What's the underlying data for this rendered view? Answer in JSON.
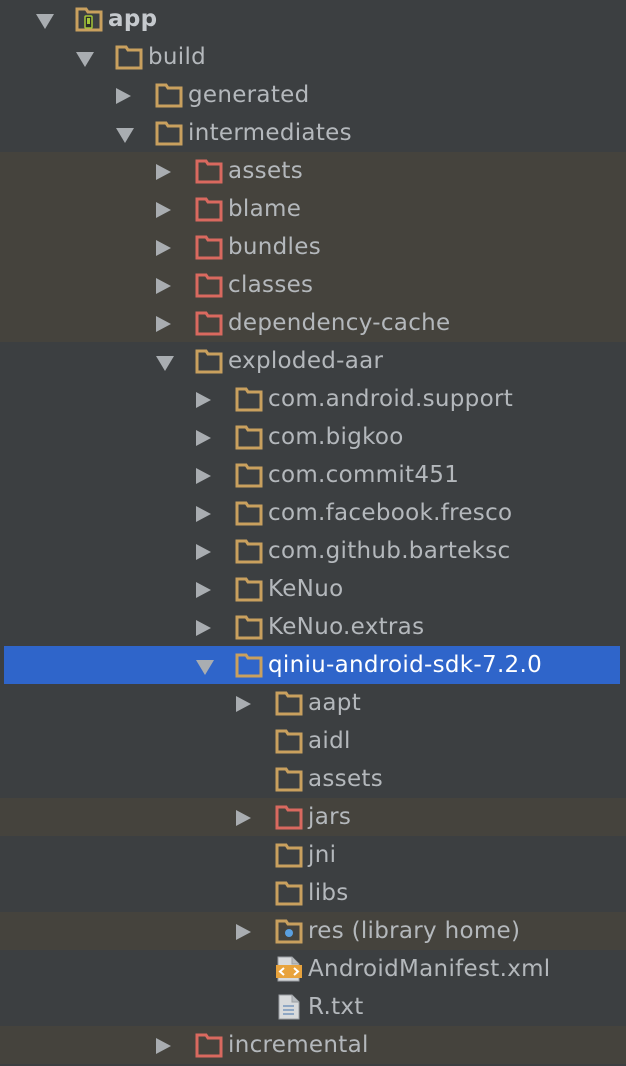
{
  "tree": [
    {
      "name": "app",
      "depth": 0,
      "arrow": "down",
      "icon": "module-folder-icon",
      "color": "#c9a05e",
      "bold": true
    },
    {
      "name": "build",
      "depth": 1,
      "arrow": "down",
      "icon": "folder-icon",
      "color": "#c9a05e"
    },
    {
      "name": "generated",
      "depth": 2,
      "arrow": "right",
      "icon": "folder-icon",
      "color": "#c9a05e"
    },
    {
      "name": "intermediates",
      "depth": 2,
      "arrow": "down",
      "icon": "folder-icon",
      "color": "#c9a05e"
    },
    {
      "name": "assets",
      "depth": 3,
      "arrow": "right",
      "icon": "excluded-folder-icon",
      "color": "#d9695f",
      "excluded": true
    },
    {
      "name": "blame",
      "depth": 3,
      "arrow": "right",
      "icon": "excluded-folder-icon",
      "color": "#d9695f",
      "excluded": true
    },
    {
      "name": "bundles",
      "depth": 3,
      "arrow": "right",
      "icon": "excluded-folder-icon",
      "color": "#d9695f",
      "excluded": true
    },
    {
      "name": "classes",
      "depth": 3,
      "arrow": "right",
      "icon": "excluded-folder-icon",
      "color": "#d9695f",
      "excluded": true
    },
    {
      "name": "dependency-cache",
      "depth": 3,
      "arrow": "right",
      "icon": "excluded-folder-icon",
      "color": "#d9695f",
      "excluded": true
    },
    {
      "name": "exploded-aar",
      "depth": 3,
      "arrow": "down",
      "icon": "folder-icon",
      "color": "#c9a05e"
    },
    {
      "name": "com.android.support",
      "depth": 4,
      "arrow": "right",
      "icon": "folder-icon",
      "color": "#c9a05e"
    },
    {
      "name": "com.bigkoo",
      "depth": 4,
      "arrow": "right",
      "icon": "folder-icon",
      "color": "#c9a05e"
    },
    {
      "name": "com.commit451",
      "depth": 4,
      "arrow": "right",
      "icon": "folder-icon",
      "color": "#c9a05e"
    },
    {
      "name": "com.facebook.fresco",
      "depth": 4,
      "arrow": "right",
      "icon": "folder-icon",
      "color": "#c9a05e"
    },
    {
      "name": "com.github.barteksc",
      "depth": 4,
      "arrow": "right",
      "icon": "folder-icon",
      "color": "#c9a05e"
    },
    {
      "name": "KeNuo",
      "depth": 4,
      "arrow": "right",
      "icon": "folder-icon",
      "color": "#c9a05e"
    },
    {
      "name": "KeNuo.extras",
      "depth": 4,
      "arrow": "right",
      "icon": "folder-icon",
      "color": "#c9a05e"
    },
    {
      "name": "qiniu-android-sdk-7.2.0",
      "depth": 4,
      "arrow": "down",
      "icon": "folder-icon",
      "color": "#c9a05e",
      "selected": true
    },
    {
      "name": "aapt",
      "depth": 5,
      "arrow": "right",
      "icon": "folder-icon",
      "color": "#c9a05e"
    },
    {
      "name": "aidl",
      "depth": 5,
      "arrow": "none",
      "icon": "folder-icon",
      "color": "#c9a05e"
    },
    {
      "name": "assets",
      "depth": 5,
      "arrow": "none",
      "icon": "folder-icon",
      "color": "#c9a05e"
    },
    {
      "name": "jars",
      "depth": 5,
      "arrow": "right",
      "icon": "excluded-folder-icon",
      "color": "#d9695f",
      "excluded": true
    },
    {
      "name": "jni",
      "depth": 5,
      "arrow": "none",
      "icon": "folder-icon",
      "color": "#c9a05e"
    },
    {
      "name": "libs",
      "depth": 5,
      "arrow": "none",
      "icon": "folder-icon",
      "color": "#c9a05e"
    },
    {
      "name": "res (library home)",
      "depth": 5,
      "arrow": "right",
      "icon": "resource-folder-icon",
      "color": "#c9a05e",
      "excluded": true
    },
    {
      "name": "AndroidManifest.xml",
      "depth": 5,
      "arrow": "none",
      "icon": "xml-file-icon",
      "color": "#e8a33d"
    },
    {
      "name": "R.txt",
      "depth": 5,
      "arrow": "none",
      "icon": "text-file-icon",
      "color": "#8fa7c4"
    },
    {
      "name": "incremental",
      "depth": 3,
      "arrow": "right",
      "icon": "excluded-folder-icon",
      "color": "#d9695f",
      "excluded": true
    }
  ]
}
